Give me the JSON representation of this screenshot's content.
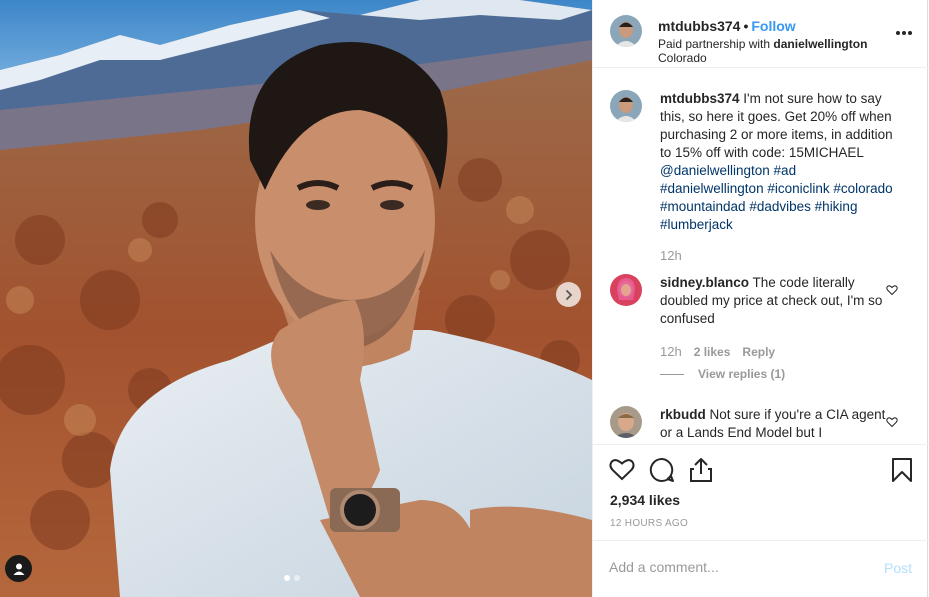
{
  "post": {
    "next_icon": "chevron-right-icon",
    "tag_icon": "user-tag-icon",
    "carousel_count": 2,
    "carousel_active": 1
  },
  "header": {
    "username": "mtdubbs374",
    "separator": "•",
    "follow_label": "Follow",
    "partnership_prefix": "Paid partnership with ",
    "partner": "danielwellington",
    "location": "Colorado",
    "more_icon": "more-horizontal-icon"
  },
  "caption": {
    "username": "mtdubbs374",
    "text_1": " I'm not sure how to say this, so here it goes. Get 20% off when purchasing 2 or more items, in addition to 15% off with code: 15MICHAEL ",
    "mention": "@danielwellington",
    "hashtags": [
      "#ad",
      "#danielwellington",
      "#iconiclink",
      "#colorado",
      "#mountaindad",
      "#dadvibes",
      "#hiking",
      "#lumberjack"
    ],
    "time": "12h"
  },
  "comments": [
    {
      "username": "sidney.blanco",
      "text": " The code literally doubled my price at check out, I'm so confused",
      "time": "12h",
      "likes": "2 likes",
      "reply_label": "Reply",
      "view_replies": "View replies (1)"
    },
    {
      "username": "rkbudd",
      "text": " Not sure if you're a CIA agent or a Lands End Model but I"
    }
  ],
  "actions": {
    "like_icon": "heart-icon",
    "comment_icon": "comment-icon",
    "share_icon": "share-icon",
    "save_icon": "bookmark-icon",
    "likes": "2,934 likes",
    "timestamp": "12 HOURS AGO"
  },
  "add_comment": {
    "placeholder": "Add a comment...",
    "post_label": "Post"
  },
  "colors": {
    "link": "#003569",
    "follow": "#3897f0",
    "muted": "#999999",
    "post_disabled": "#b2dffc"
  }
}
